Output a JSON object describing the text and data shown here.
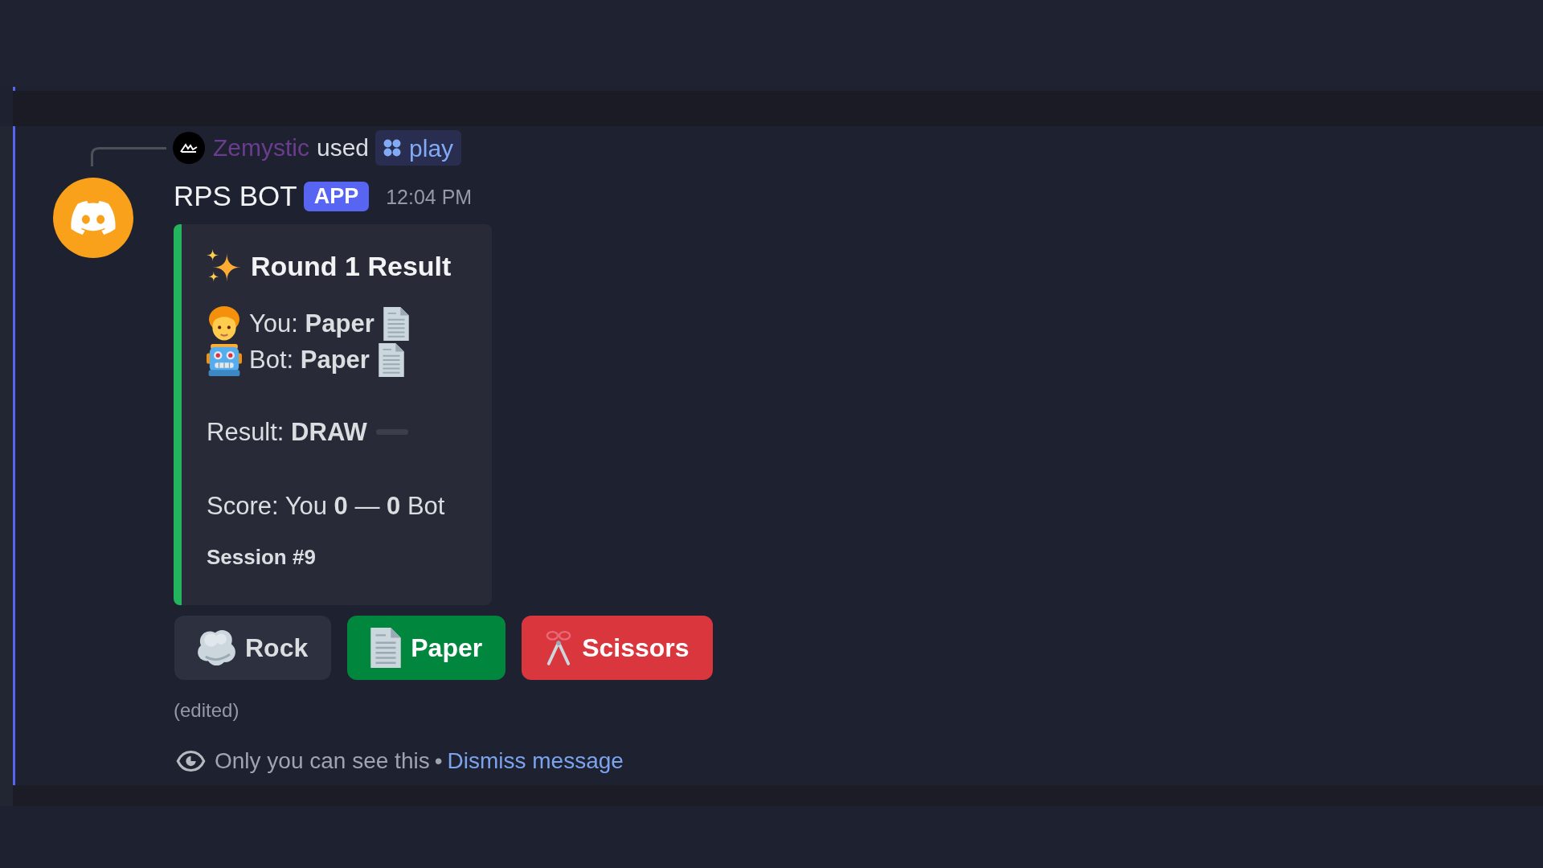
{
  "reply": {
    "username": "Zemystic",
    "action": "used",
    "command": "play"
  },
  "message": {
    "author": "RPS BOT",
    "badge": "APP",
    "timestamp": "12:04 PM",
    "embed": {
      "title": "Round 1 Result",
      "players": [
        {
          "kind": "human",
          "text": "You: **Paper**"
        },
        {
          "kind": "bot",
          "text": "Bot: **Paper**"
        }
      ],
      "result": "Result: **DRAW**",
      "score": "Score: You **0** — **0** Bot",
      "footer": "Session #9"
    },
    "buttons": [
      {
        "label": "Rock",
        "kind": "secondary"
      },
      {
        "label": "Paper",
        "kind": "success"
      },
      {
        "label": "Scissors",
        "kind": "danger"
      }
    ],
    "edited": "(edited)",
    "notice": {
      "text": "Only you can see this",
      "separator": "•",
      "link": "Dismiss message"
    }
  }
}
